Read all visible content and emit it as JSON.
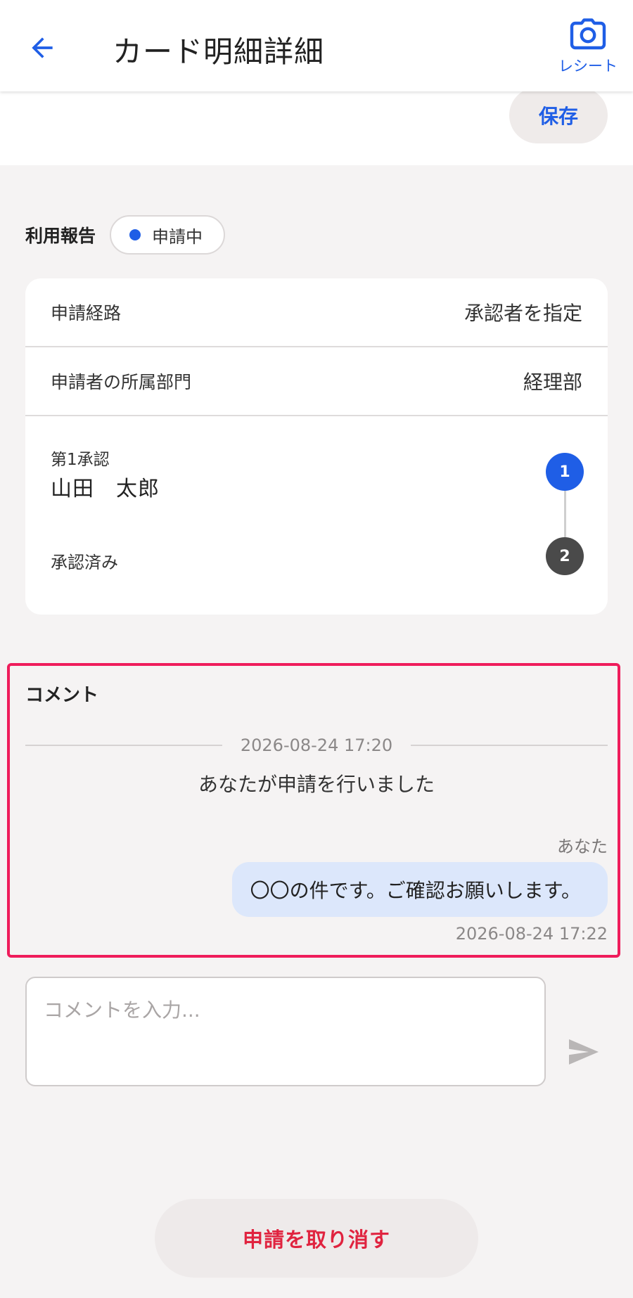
{
  "header": {
    "title": "カード明細詳細",
    "back_icon": "arrow-left-icon",
    "receipt_icon": "camera-icon",
    "receipt_label": "レシート"
  },
  "toolbar": {
    "save_label": "保存"
  },
  "report": {
    "label": "利用報告",
    "status": "申請中",
    "status_color": "#1f5ee6"
  },
  "details": {
    "route_label": "申請経路",
    "route_value": "承認者を指定",
    "department_label": "申請者の所属部門",
    "department_value": "経理部"
  },
  "approval": {
    "steps": [
      {
        "number": "1",
        "title": "第1承認",
        "person": "山田　太郎",
        "color": "#1f5ee6"
      },
      {
        "number": "2",
        "title": "承認済み",
        "color": "#4a4a4a"
      }
    ]
  },
  "comments": {
    "title": "コメント",
    "date_divider": "2026-08-24 17:20",
    "system_message": "あなたが申請を行いました",
    "messages": [
      {
        "author": "あなた",
        "text": "〇〇の件です。ご確認お願いします。",
        "time": "2026-08-24 17:22"
      }
    ],
    "input_placeholder": "コメントを入力...",
    "send_icon": "send-icon"
  },
  "actions": {
    "cancel_label": "申請を取り消す",
    "cancel_color": "#e0233f"
  },
  "colors": {
    "accent": "#1f5ee6",
    "highlight_border": "#ef1c5b",
    "bubble": "#dce7fb"
  }
}
